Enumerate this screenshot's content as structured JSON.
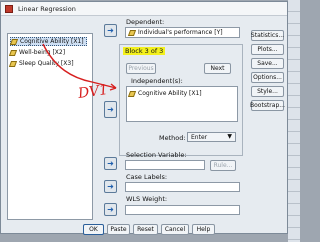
{
  "window": {
    "title": "Linear Regression"
  },
  "variables": [
    {
      "label": "Cognitive Ability [X1]",
      "selected": true
    },
    {
      "label": "Well-being [X2]",
      "selected": false
    },
    {
      "label": "Sleep Quality [X3]",
      "selected": false
    }
  ],
  "dependent": {
    "label": "Dependent:",
    "value": "Individual's performance [Y]"
  },
  "block": {
    "label": "Block 3 of 3",
    "previous": "Previous",
    "next": "Next"
  },
  "independents": {
    "label": "Independent(s):",
    "items": [
      "Cognitive Ability [X1]"
    ]
  },
  "method": {
    "label": "Method:",
    "value": "Enter"
  },
  "selection_variable": {
    "label": "Selection Variable:",
    "rule": "Rule..."
  },
  "case_labels": {
    "label": "Case Labels:"
  },
  "wls_weight": {
    "label": "WLS Weight:"
  },
  "side_buttons": [
    "Statistics...",
    "Plots...",
    "Save...",
    "Options...",
    "Style...",
    "Bootstrap..."
  ],
  "bottom_buttons": {
    "ok": "OK",
    "paste": "Paste",
    "reset": "Reset",
    "cancel": "Cancel",
    "help": "Help"
  },
  "annotation": {
    "text": "DV1",
    "color": "#d71f1f"
  },
  "highlight_color": "#f3f01c"
}
